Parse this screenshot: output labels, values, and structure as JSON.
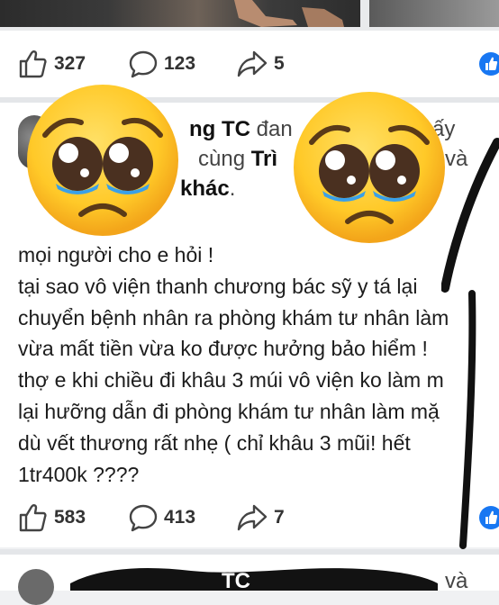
{
  "post_top": {
    "reactions": {
      "likes": "327",
      "comments": "123",
      "shares": "5"
    }
  },
  "post_main": {
    "header": {
      "name_fragment": "ng TC",
      "suffix_1": "đan",
      "suffix_2": "ấy",
      "with_text": "cùng",
      "tag_bold": "Trì",
      "and_text": "và",
      "others_bold": "khác",
      "period": "."
    },
    "body": "mọi người cho e hỏi !\ntại sao vô viện thanh chương bác sỹ y tá lại\nchuyển bệnh nhân ra phòng khám tư nhân làm\nvừa mất tiền vừa ko được hưởng bảo hiểm !\nthợ e khi chiều đi khâu 3 múi vô viện ko làm m\nlại hưỡng dẫn đi phòng khám tư nhân làm mặ\ndù vết thương rất nhẹ ( chỉ khâu 3 mũi! hết\n1tr400k ????",
    "reactions": {
      "likes": "583",
      "comments": "413",
      "shares": "7"
    }
  },
  "post_next": {
    "header_fragment": "TC",
    "header_suffix": "và"
  },
  "colors": {
    "fb_blue": "#1877f2",
    "emoji_yellow": "#ffc928",
    "tear_blue": "#3aa0e8"
  },
  "icons": [
    "like-icon",
    "comment-icon",
    "share-icon",
    "pleading-face-emoji"
  ]
}
